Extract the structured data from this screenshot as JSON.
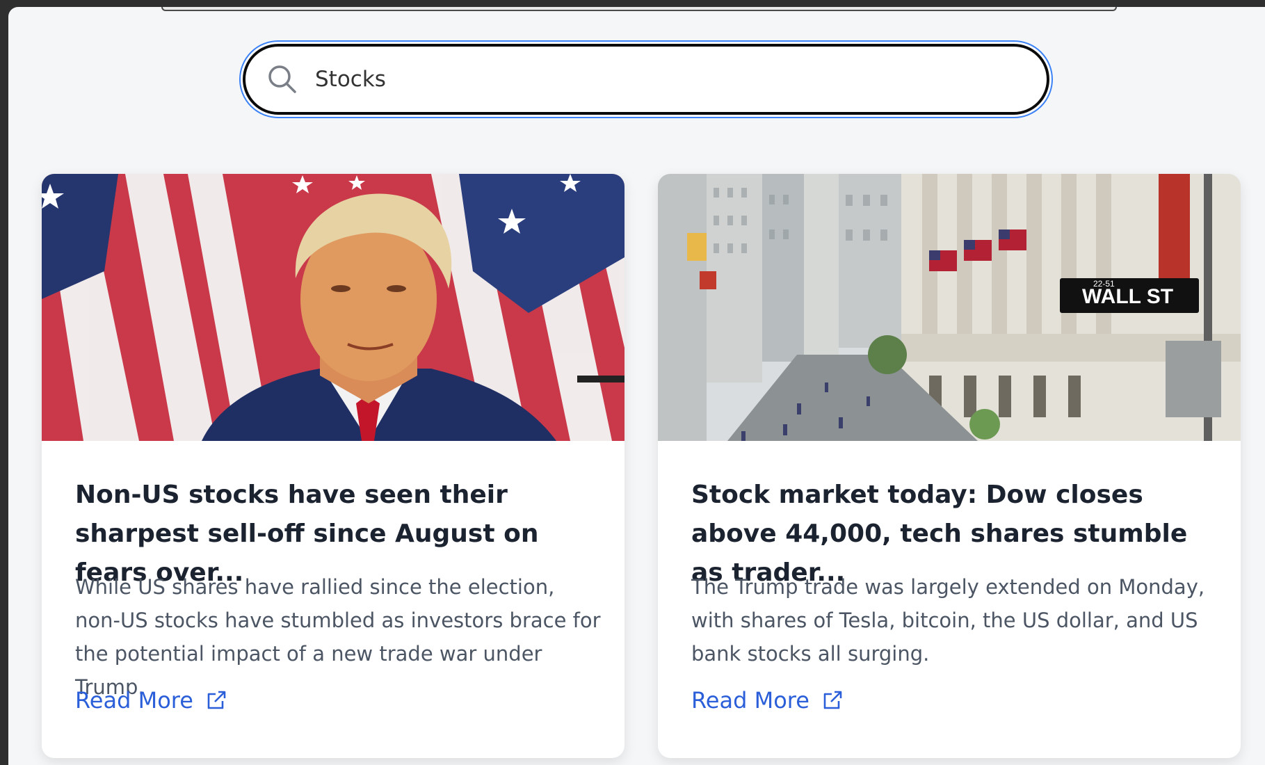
{
  "search": {
    "value": "Stocks",
    "icon": "search-icon"
  },
  "colors": {
    "accent": "#2b5fd9",
    "focus_ring": "#3b82f6",
    "title": "#1c2330",
    "body_text": "#4b5563"
  },
  "articles": [
    {
      "title": "Non-US stocks have seen their sharpest sell-off since August on fears over...",
      "description": "While US shares have rallied since the election, non-US stocks have stumbled as investors brace for the potential impact of a new trade war under Trump.",
      "link_label": "Read More",
      "link_icon": "external-link-icon"
    },
    {
      "title": "Stock market today: Dow closes above 44,000, tech shares stumble as trader...",
      "description": "The Trump trade was largely extended on Monday, with shares of Tesla, bitcoin, the US dollar, and US bank stocks all surging.",
      "link_label": "Read More",
      "link_icon": "external-link-icon",
      "image_sign_text": "WALL ST",
      "image_sign_number": "22-51"
    }
  ]
}
